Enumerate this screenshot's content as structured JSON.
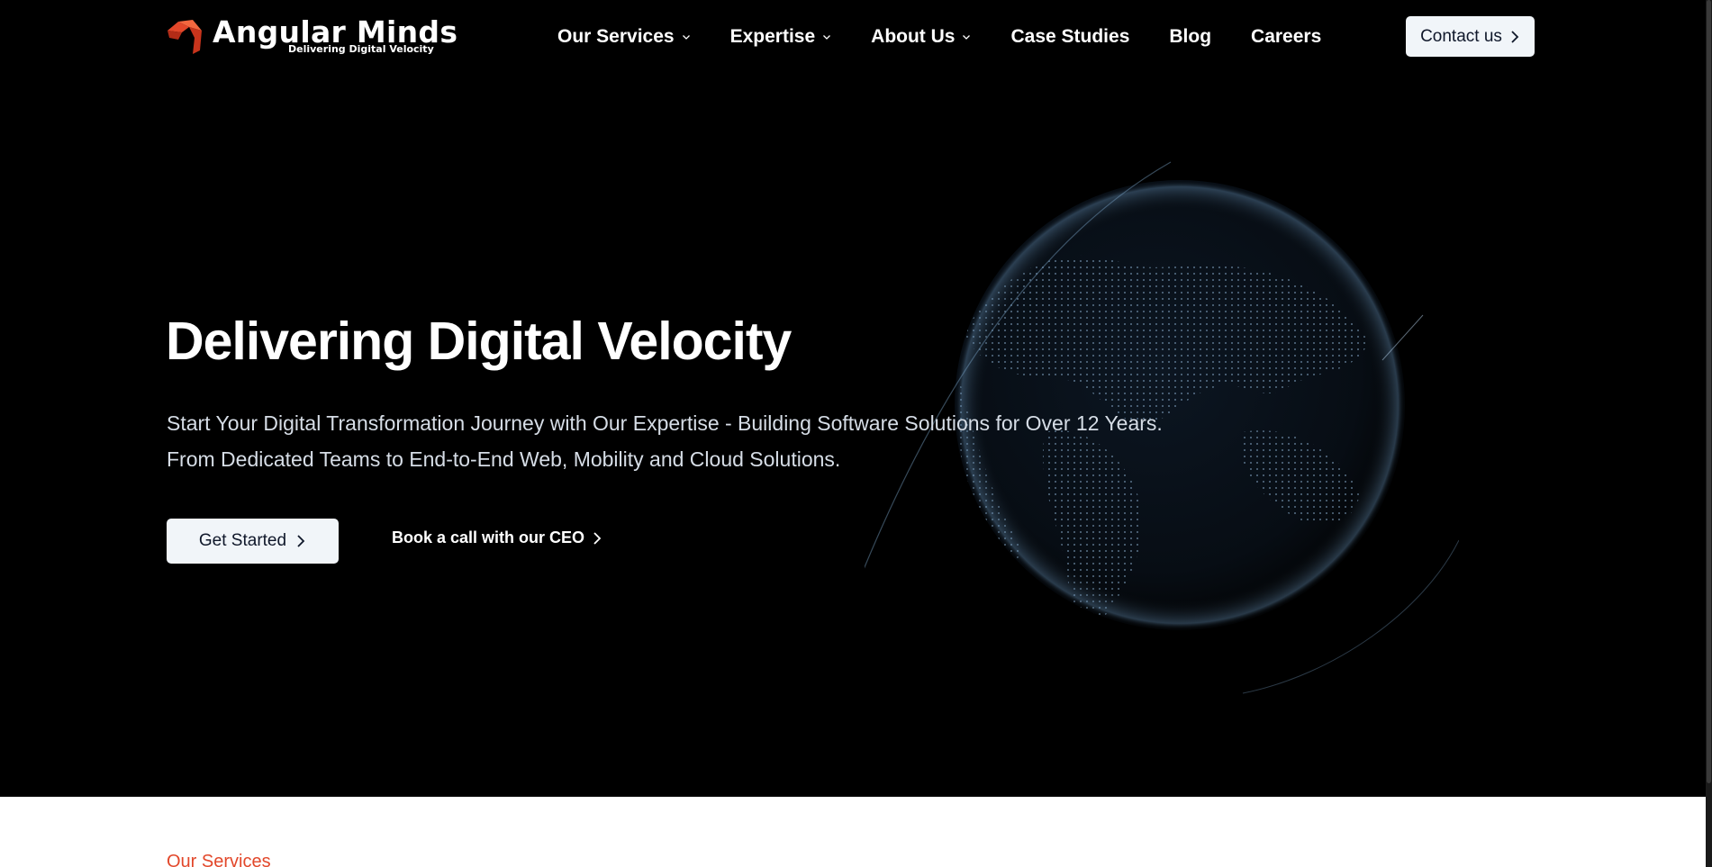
{
  "brand": {
    "name": "Angular Minds",
    "tagline": "Delivering Digital Velocity",
    "colors": {
      "primary": "#e2472a",
      "hero_bg": "#000000",
      "button_bg": "#f1f5f9"
    }
  },
  "nav": {
    "items": [
      {
        "label": "Our Services",
        "has_dropdown": true
      },
      {
        "label": "Expertise",
        "has_dropdown": true
      },
      {
        "label": "About Us",
        "has_dropdown": true
      },
      {
        "label": "Case Studies",
        "has_dropdown": false
      },
      {
        "label": "Blog",
        "has_dropdown": false
      },
      {
        "label": "Careers",
        "has_dropdown": false
      }
    ],
    "contact_label": "Contact us"
  },
  "hero": {
    "title": "Delivering Digital Velocity",
    "subtitle_line1": "Start Your Digital Transformation Journey with Our Expertise - Building Software Solutions for Over 12 Years.",
    "subtitle_line2": "From Dedicated Teams to End-to-End Web, Mobility and Cloud Solutions.",
    "primary_cta": "Get Started",
    "secondary_cta": "Book a call with our CEO"
  },
  "services_section": {
    "label": "Our Services"
  },
  "icons": {
    "dropdown": "chevron-down-icon",
    "arrow": "chevron-right-icon",
    "globe": "globe-image"
  }
}
